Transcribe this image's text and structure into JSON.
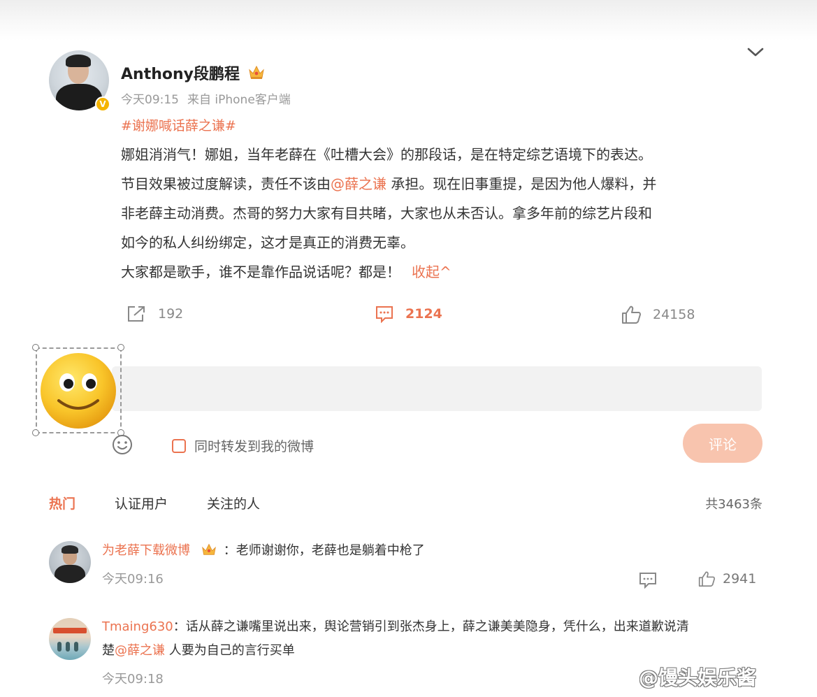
{
  "post": {
    "author": "Anthony段鹏程",
    "verified_mark": "V",
    "time": "今天09:15",
    "source": "来自 iPhone客户端",
    "topic": "#谢娜喊话薛之谦#",
    "lines": [
      "娜姐消消气！娜姐，当年老薛在《吐槽大会》的那段话，是在特定综艺语境下的表达。",
      "节目效果被过度解读，责任不该由",
      "@薛之谦",
      " 承担。现在旧事重提，是因为他人爆料，并",
      "非老薛主动消费。杰哥的努力大家有目共睹，大家也从未否认。拿多年前的综艺片段和",
      "如今的私人纠纷绑定，这才是真正的消费无辜。",
      "大家都是歌手，谁不是靠作品说话呢？都是！"
    ],
    "collapse_label": "收起^",
    "reposts": "192",
    "comments": "2124",
    "likes": "24158"
  },
  "reply_box": {
    "repost_label": "同时转发到我的微博",
    "submit_label": "评论"
  },
  "comment_tabs": [
    "热门",
    "认证用户",
    "关注的人"
  ],
  "total_comments": "共3463条",
  "comments": [
    {
      "user": "为老薛下载微博",
      "text": "：老师谢谢你，老薛也是躺着中枪了",
      "time": "今天09:16",
      "likes": "2941"
    },
    {
      "user": "Tmaing630",
      "text_line1": "：话从薛之谦嘴里说出来，舆论营销引到张杰身上，薛之谦美美隐身，凭什么，出来道歉说清",
      "text_line2_prefix": "楚",
      "mention": "@薛之谦",
      "text_line2_suffix": " 人要为自己的言行买单",
      "time": "今天09:18"
    }
  ],
  "watermark": "@馒头娱乐酱",
  "icons": [
    "chevron-down-icon",
    "crown-icon",
    "repost-icon",
    "comment-icon",
    "like-icon",
    "smiley-emoji-icon",
    "emoji-picker-icon"
  ],
  "colors": {
    "accent": "#eb7350",
    "button_disabled": "#f8c4ae",
    "verified": "#f5b400"
  }
}
